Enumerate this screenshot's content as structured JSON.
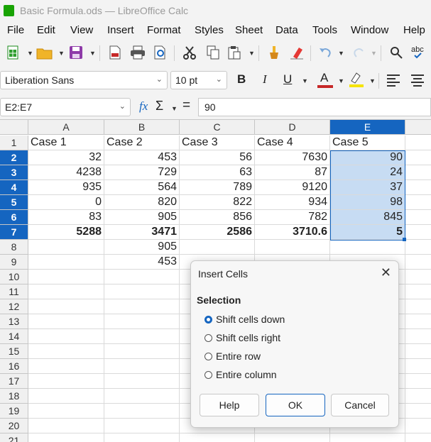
{
  "window": {
    "title": "Basic Formula.ods — LibreOffice Calc"
  },
  "menu": [
    "File",
    "Edit",
    "View",
    "Insert",
    "Format",
    "Styles",
    "Sheet",
    "Data",
    "Tools",
    "Window",
    "Help"
  ],
  "format": {
    "font_name": "Liberation Sans",
    "font_size": "10 pt",
    "bold": "B",
    "italic": "I",
    "underline": "U",
    "font_color_letter": "A"
  },
  "formula_bar": {
    "name_box": "E2:E7",
    "function_icon": "fx",
    "sum_icon": "Σ",
    "equals": "=",
    "content": "90"
  },
  "columns": [
    "A",
    "B",
    "C",
    "D",
    "E"
  ],
  "selected_column": "E",
  "rows": [
    "1",
    "2",
    "3",
    "4",
    "5",
    "6",
    "7",
    "8",
    "9",
    "10",
    "11",
    "12",
    "13",
    "14",
    "15",
    "16",
    "17",
    "18",
    "19",
    "20",
    "21"
  ],
  "selected_rows": [
    "2",
    "3",
    "4",
    "5",
    "6",
    "7"
  ],
  "cells": {
    "r1": [
      "Case 1",
      "Case 2",
      "Case 3",
      "Case 4",
      "Case 5"
    ],
    "r2": [
      "32",
      "453",
      "56",
      "7630",
      "90"
    ],
    "r3": [
      "4238",
      "729",
      "63",
      "87",
      "24"
    ],
    "r4": [
      "935",
      "564",
      "789",
      "9120",
      "37"
    ],
    "r5": [
      "0",
      "820",
      "822",
      "934",
      "98"
    ],
    "r6": [
      "83",
      "905",
      "856",
      "782",
      "845"
    ],
    "r7": [
      "5288",
      "3471",
      "2586",
      "3710.6",
      "5"
    ],
    "r8": [
      "",
      "905",
      "",
      "",
      ""
    ],
    "r9": [
      "",
      "453",
      "",
      "",
      ""
    ]
  },
  "dialog": {
    "title": "Insert Cells",
    "section": "Selection",
    "options": [
      {
        "label": "Shift cells down",
        "selected": true
      },
      {
        "label": "Shift cells right",
        "selected": false
      },
      {
        "label": "Entire row",
        "selected": false
      },
      {
        "label": "Entire column",
        "selected": false
      }
    ],
    "buttons": {
      "help": "Help",
      "ok": "OK",
      "cancel": "Cancel"
    }
  },
  "icons": {
    "toolbar": [
      "new-spreadsheet-icon",
      "open-icon",
      "save-icon",
      "export-pdf-icon",
      "print-icon",
      "print-preview-icon",
      "cut-icon",
      "copy-icon",
      "paste-icon",
      "clone-formatting-icon",
      "clear-formatting-icon",
      "undo-icon",
      "redo-icon",
      "find-replace-icon",
      "spelling-icon"
    ]
  },
  "colors": {
    "accent": "#1565c0",
    "selection_fill": "#c7dcf3",
    "font_color_bar": "#c62828",
    "highlight_bar": "#f5e400"
  }
}
